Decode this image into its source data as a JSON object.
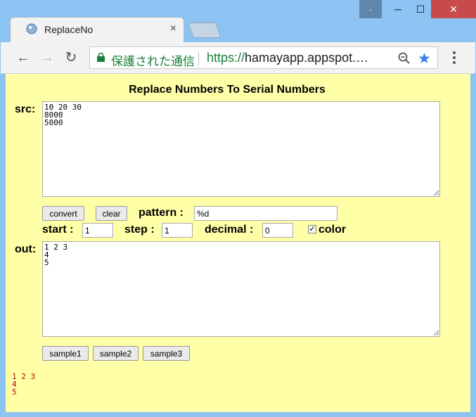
{
  "window": {
    "tab_title": "ReplaceNo",
    "tab_close": "×",
    "help_label": "·",
    "min_label": "─",
    "max_label": "☐",
    "close_label": "✕"
  },
  "toolbar": {
    "back": "←",
    "forward": "→",
    "reload": "↻",
    "secure_text": "保護された通信",
    "url_scheme": "https://",
    "url_host": "hamayapp.appspot.…",
    "star": "★"
  },
  "page": {
    "title": "Replace Numbers To Serial Numbers",
    "src_label": "src:",
    "src_value": "10 20 30\n8000\n5000",
    "convert_label": "convert",
    "clear_label": "clear",
    "pattern_label": "pattern :",
    "pattern_value": "%d",
    "start_label": "start :",
    "start_value": "1",
    "step_label": "step :",
    "step_value": "1",
    "decimal_label": "decimal :",
    "decimal_value": "0",
    "color_label": "color",
    "color_checked": true,
    "out_label": "out:",
    "out_value": "1 2 3\n4\n5",
    "sample1_label": "sample1",
    "sample2_label": "sample2",
    "sample3_label": "sample3",
    "result_text": "1 2 3\n4\n5"
  },
  "colors": {
    "page_background": "#ffffa8",
    "result_text": "#c00000",
    "secure_green": "#188038",
    "titlebar": "#8cc3f2"
  }
}
